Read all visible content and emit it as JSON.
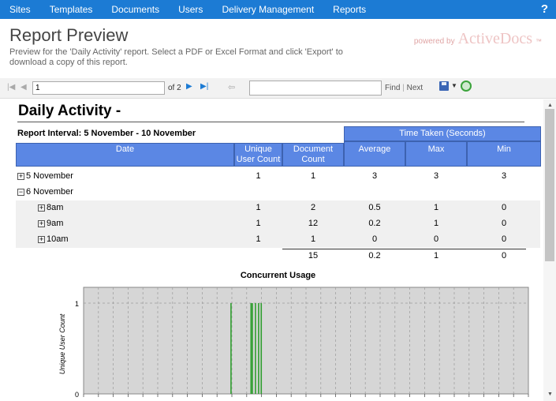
{
  "nav": {
    "items": [
      "Sites",
      "Templates",
      "Documents",
      "Users",
      "Delivery Management",
      "Reports"
    ],
    "help": "?"
  },
  "header": {
    "title": "Report Preview",
    "subtitle": "Preview for the 'Daily Activity' report. Select a PDF or Excel Format and click 'Export' to download a copy of this report.",
    "powered_by": "powered by",
    "brand": "ActiveDocs",
    "brand_tm": "™"
  },
  "toolbar": {
    "page_value": "1",
    "page_of": "of 2",
    "find": "Find",
    "separator": "|",
    "next": "Next"
  },
  "report": {
    "title": "Daily Activity -",
    "interval": "Report Interval: 5 November - 10 November",
    "time_taken_header": "Time Taken (Seconds)",
    "columns": [
      "Date",
      "Unique User Count",
      "Document Count",
      "Average",
      "Max",
      "Min"
    ],
    "rows": [
      {
        "date": "5 November",
        "toggle": "+",
        "indent": 0,
        "unique": "1",
        "docs": "1",
        "avg": "3",
        "max": "3",
        "min": "3"
      },
      {
        "date": "6 November",
        "toggle": "−",
        "indent": 0,
        "unique": "",
        "docs": "",
        "avg": "",
        "max": "",
        "min": ""
      },
      {
        "date": "8am",
        "toggle": "+",
        "indent": 1,
        "unique": "1",
        "docs": "2",
        "avg": "0.5",
        "max": "1",
        "min": "0"
      },
      {
        "date": "9am",
        "toggle": "+",
        "indent": 1,
        "unique": "1",
        "docs": "12",
        "avg": "0.2",
        "max": "1",
        "min": "0"
      },
      {
        "date": "10am",
        "toggle": "+",
        "indent": 1,
        "unique": "1",
        "docs": "1",
        "avg": "0",
        "max": "0",
        "min": "0"
      }
    ],
    "totals": {
      "docs": "15",
      "avg": "0.2",
      "max": "1",
      "min": "0"
    }
  },
  "chart_data": {
    "type": "bar",
    "title": "Concurrent Usage",
    "ylabel": "Unique User Count",
    "yticks": [
      "1",
      "0"
    ],
    "ylim": [
      0,
      1
    ],
    "series_color": "#2e9e2e",
    "bars": [
      {
        "x_fraction": 0.33,
        "value": 1
      },
      {
        "x_fraction": 0.375,
        "value": 1
      },
      {
        "x_fraction": 0.378,
        "value": 1
      },
      {
        "x_fraction": 0.385,
        "value": 1
      },
      {
        "x_fraction": 0.392,
        "value": 1
      },
      {
        "x_fraction": 0.398,
        "value": 1
      }
    ],
    "grid": true
  },
  "colors": {
    "nav_bg": "#1c7bd4",
    "header_cell": "#5b87e4",
    "chart_bg": "#d6d6d6"
  }
}
